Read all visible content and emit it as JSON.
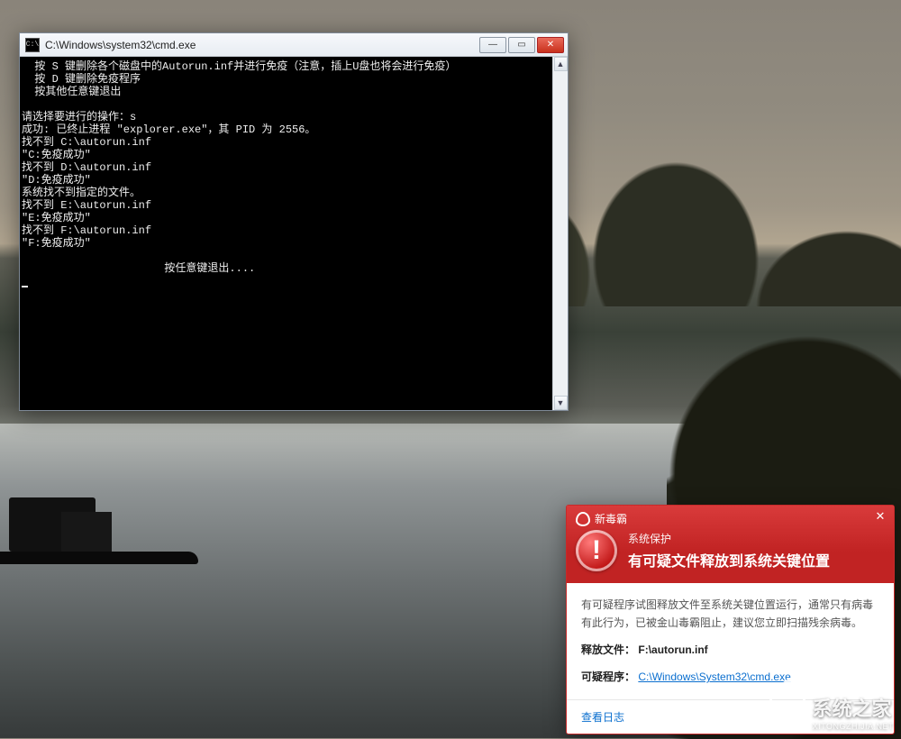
{
  "cmd": {
    "title": "C:\\Windows\\system32\\cmd.exe",
    "icon_text": "C:\\",
    "lines": [
      "  按 S 键删除各个磁盘中的Autorun.inf并进行免疫（注意，插上U盘也将会进行免疫）",
      "  按 D 键删除免疫程序",
      "  按其他任意键退出",
      "",
      "请选择要进行的操作：s",
      "成功: 已终止进程 \"explorer.exe\"，其 PID 为 2556。",
      "找不到 C:\\autorun.inf",
      "\"C:免疫成功\"",
      "找不到 D:\\autorun.inf",
      "\"D:免疫成功\"",
      "系统找不到指定的文件。",
      "找不到 E:\\autorun.inf",
      "\"E:免疫成功\"",
      "找不到 F:\\autorun.inf",
      "\"F:免疫成功\"",
      "",
      "                      按任意键退出...."
    ]
  },
  "av": {
    "brand": "新毒霸",
    "subtitle": "系统保护",
    "title": "有可疑文件释放到系统关键位置",
    "desc": "有可疑程序试图释放文件至系统关键位置运行，通常只有病毒有此行为，已被金山毒霸阻止，建议您立即扫描残余病毒。",
    "file_label": "释放文件：",
    "file_value": "F:\\autorun.inf",
    "proc_label": "可疑程序：",
    "proc_link": "C:\\Windows\\System32\\cmd.exe",
    "log": "查看日志"
  },
  "watermark": {
    "name": "系统之家",
    "sub": "XITONGZHIJIA.NET"
  }
}
